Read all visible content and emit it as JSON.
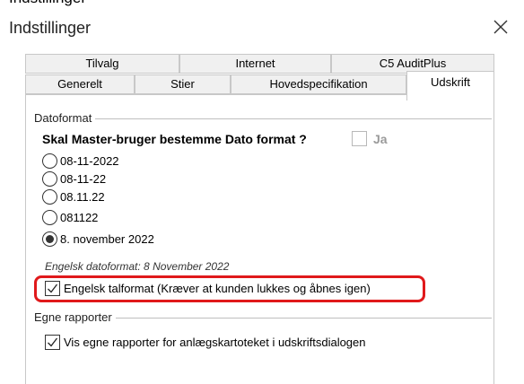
{
  "window": {
    "clipped_title": "Indstillinger",
    "title": "Indstillinger",
    "close_icon": "close-icon"
  },
  "tabs": {
    "top_row": [
      "Tilvalg",
      "Internet",
      "C5 AuditPlus"
    ],
    "bottom_row": [
      "Generelt",
      "Stier",
      "Hovedspecifikation"
    ],
    "selected": "Udskrift"
  },
  "datoformat": {
    "group_label": "Datoformat",
    "question": "Skal Master-bruger bestemme Dato format ?",
    "question_checked": false,
    "question_checkbox_label": "Ja",
    "options": [
      {
        "label": "08-11-2022",
        "selected": false
      },
      {
        "label": "08-11-22",
        "selected": false
      },
      {
        "label": "08.11.22",
        "selected": false
      },
      {
        "label": "081122",
        "selected": false
      },
      {
        "label": "8. november 2022",
        "selected": true
      }
    ],
    "english_hint": "Engelsk datoformat: 8 November 2022",
    "english_number_format": {
      "label": "Engelsk talformat (Kræver at kunden lukkes og åbnes igen)",
      "checked": true
    }
  },
  "egne_rapporter": {
    "group_label": "Egne rapporter",
    "option": {
      "label": "Vis egne rapporter for anlægskartoteket i udskriftsdialogen",
      "checked": true
    }
  },
  "colors": {
    "highlight": "#e0191b",
    "tab_bg": "#f0f0f0",
    "border": "#c8c8c8",
    "disabled_text": "#9a9a9a"
  }
}
